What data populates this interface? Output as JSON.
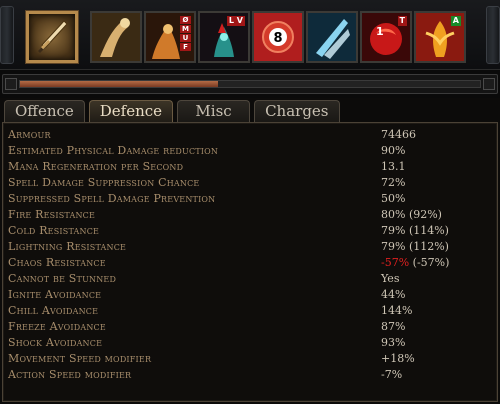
{
  "skillbar": {
    "slots": [
      {
        "icon": "dagger-icon",
        "selected": true
      },
      {
        "icon": "arm-gesture-icon",
        "selected": false
      },
      {
        "icon": "fire-warrior-icon",
        "badges": [
          "Ø",
          "M",
          "U",
          "F"
        ]
      },
      {
        "icon": "ghost-figure-icon",
        "badges": [
          "L",
          "V"
        ]
      },
      {
        "icon": "number-eight-icon",
        "badge_text": "8"
      },
      {
        "icon": "ice-slash-icon"
      },
      {
        "icon": "blood-rage-icon",
        "badge_text": "1",
        "badge_corner": "T"
      },
      {
        "icon": "flame-dancer-icon",
        "badge_corner": "A"
      }
    ]
  },
  "progress": {
    "fraction": 0.43,
    "fill_color": "#b46c46"
  },
  "tabs": [
    {
      "label": "Offence",
      "active": false
    },
    {
      "label": "Defence",
      "active": true
    },
    {
      "label": "Misc",
      "active": false
    },
    {
      "label": "Charges",
      "active": false
    }
  ],
  "stats": [
    {
      "label": "Armour",
      "value": "74466"
    },
    {
      "label": "Estimated Physical Damage reduction",
      "value": "90%"
    },
    {
      "label": "Mana Regeneration per Second",
      "value": "13.1"
    },
    {
      "label": "Spell Damage Suppression Chance",
      "value": "72%"
    },
    {
      "label": "Suppressed Spell Damage Prevention",
      "value": "50%"
    },
    {
      "label": "Fire Resistance",
      "value": "80% (92%)"
    },
    {
      "label": "Cold Resistance",
      "value": "79% (114%)"
    },
    {
      "label": "Lightning Resistance",
      "value": "79% (112%)"
    },
    {
      "label": "Chaos Resistance",
      "value_neg": "-57%",
      "value_rest": " (-57%)"
    },
    {
      "label": "Cannot be Stunned",
      "value": "Yes"
    },
    {
      "label": "Ignite Avoidance",
      "value": "44%"
    },
    {
      "label": "Chill Avoidance",
      "value": "144%"
    },
    {
      "label": "Freeze Avoidance",
      "value": "87%"
    },
    {
      "label": "Shock Avoidance",
      "value": "93%"
    },
    {
      "label": "Movement Speed modifier",
      "value": "+18%"
    },
    {
      "label": "Action Speed modifier",
      "value": "-7%"
    }
  ],
  "colors": {
    "label": "#a88e6c",
    "value": "#cfc6b6",
    "negative": "#e02020",
    "accent_gold": "#b68a4c"
  }
}
